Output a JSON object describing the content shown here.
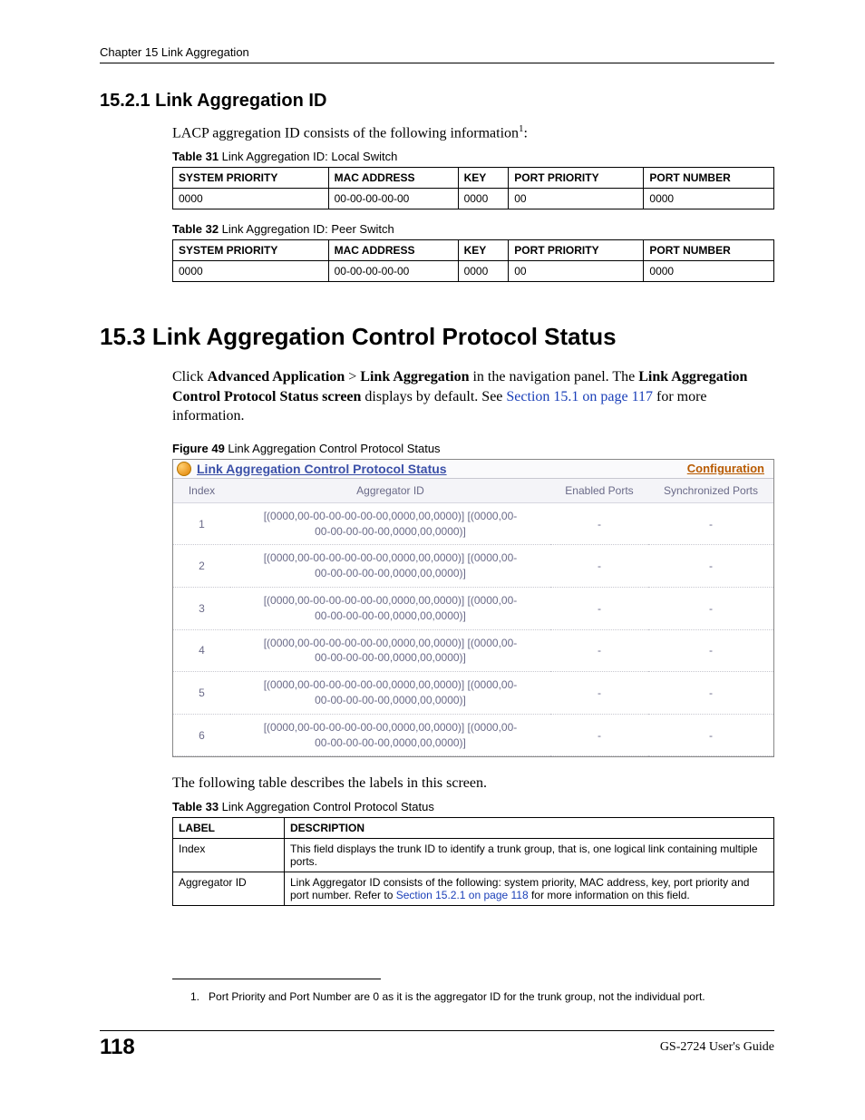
{
  "chapter_header": "Chapter 15 Link Aggregation",
  "s1": {
    "heading": "15.2.1  Link Aggregation ID",
    "intro_a": "LACP aggregation ID consists of the following information",
    "intro_b": ":",
    "sup": "1"
  },
  "t31": {
    "caption_bold": "Table 31",
    "caption_rest": "   Link Aggregation ID: Local Switch",
    "headers": [
      "SYSTEM PRIORITY",
      "MAC ADDRESS",
      "KEY",
      "PORT PRIORITY",
      "PORT NUMBER"
    ],
    "row": [
      "0000",
      "00-00-00-00-00",
      "0000",
      "00",
      "0000"
    ]
  },
  "t32": {
    "caption_bold": "Table 32",
    "caption_rest": "   Link Aggregation ID: Peer Switch",
    "headers": [
      "SYSTEM PRIORITY",
      "MAC ADDRESS",
      "KEY",
      "PORT PRIORITY",
      "PORT NUMBER"
    ],
    "row": [
      "0000",
      "00-00-00-00-00",
      "0000",
      "00",
      "0000"
    ]
  },
  "s2": {
    "heading": "15.3  Link Aggregation Control Protocol Status",
    "p_a": "Click ",
    "p_b": "Advanced Application",
    "p_c": " > ",
    "p_d": "Link Aggregation",
    "p_e": " in the navigation panel. The ",
    "p_f": "Link Aggregation Control Protocol Status screen",
    "p_g": " displays by default. See ",
    "link1": "Section 15.1 on page 117",
    "p_h": " for more information."
  },
  "fig49": {
    "caption_bold": "Figure 49",
    "caption_rest": "   Link Aggregation Control Protocol Status",
    "title": "Link Aggregation Control Protocol Status",
    "config": "Configuration",
    "cols": {
      "index": "Index",
      "agg": "Aggregator ID",
      "ep": "Enabled Ports",
      "sp": "Synchronized Ports"
    },
    "rows": [
      {
        "i": "1",
        "a1": "[(0000,00-00-00-00-00-00,0000,00,0000)] [(0000,00-",
        "a2": "00-00-00-00-00,0000,00,0000)]",
        "ep": "-",
        "sp": "-"
      },
      {
        "i": "2",
        "a1": "[(0000,00-00-00-00-00-00,0000,00,0000)] [(0000,00-",
        "a2": "00-00-00-00-00,0000,00,0000)]",
        "ep": "-",
        "sp": "-"
      },
      {
        "i": "3",
        "a1": "[(0000,00-00-00-00-00-00,0000,00,0000)] [(0000,00-",
        "a2": "00-00-00-00-00,0000,00,0000)]",
        "ep": "-",
        "sp": "-"
      },
      {
        "i": "4",
        "a1": "[(0000,00-00-00-00-00-00,0000,00,0000)] [(0000,00-",
        "a2": "00-00-00-00-00,0000,00,0000)]",
        "ep": "-",
        "sp": "-"
      },
      {
        "i": "5",
        "a1": "[(0000,00-00-00-00-00-00,0000,00,0000)] [(0000,00-",
        "a2": "00-00-00-00-00,0000,00,0000)]",
        "ep": "-",
        "sp": "-"
      },
      {
        "i": "6",
        "a1": "[(0000,00-00-00-00-00-00,0000,00,0000)] [(0000,00-",
        "a2": "00-00-00-00-00,0000,00,0000)]",
        "ep": "-",
        "sp": "-"
      }
    ]
  },
  "after_fig": "The following table describes the labels in this screen.",
  "t33": {
    "caption_bold": "Table 33",
    "caption_rest": "   Link Aggregation Control Protocol Status",
    "h1": "LABEL",
    "h2": "DESCRIPTION",
    "r1l": "Index",
    "r1d": "This field displays the trunk ID to identify a trunk group, that is, one logical link containing multiple ports.",
    "r2l": "Aggregator ID",
    "r2d_a": "Link Aggregator ID consists of the following: system priority, MAC address, key, port priority and port number. Refer to ",
    "r2d_link": "Section 15.2.1 on page 118",
    "r2d_b": " for more information on this field."
  },
  "footnote": {
    "num": "1.",
    "text": "Port Priority and Port Number are 0 as it is the aggregator ID for the trunk group, not the individual port."
  },
  "footer": {
    "page": "118",
    "guide": "GS-2724 User's Guide"
  }
}
